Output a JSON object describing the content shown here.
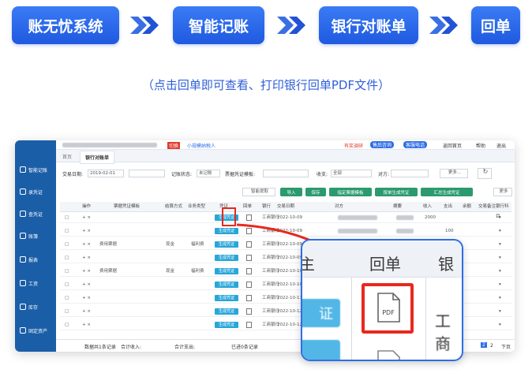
{
  "flow": {
    "steps": [
      "账无忧系统",
      "智能记账",
      "银行对账单",
      "回单"
    ]
  },
  "caption": "（点击回单即可查看、打印银行回单PDF文件）",
  "app": {
    "sidebar": [
      "智能记账",
      "录凭证",
      "查凭证",
      "账簿",
      "报表",
      "工资",
      "库存",
      "固定资产"
    ],
    "topbar": {
      "badge": "切换",
      "company": "小规模纳税人",
      "right_items": [
        "有奖调研",
        "售后咨询",
        "客服电话",
        "返回首页",
        "帮助",
        "退出"
      ]
    },
    "tabs": [
      "首页",
      "银行对账单"
    ],
    "filters": {
      "date_label": "交易日期:",
      "date_from": "2019-02-01",
      "record_label": "记账状态:",
      "record_value": "未记账",
      "template_label": "票据凭证模板:",
      "income_label": "收支:",
      "income_value": "全部",
      "party_label": "对方:",
      "more": "更多..."
    },
    "buttons": [
      "智能提取",
      "导入",
      "保存",
      "指定票据模板",
      "按单生成凭证",
      "汇总生成凭证",
      "更多"
    ],
    "columns": [
      "操作",
      "票据凭证模板",
      "结算方式",
      "业务类型",
      "凭证",
      "回单",
      "银行",
      "交易日期",
      "对方",
      "摘要",
      "收入",
      "支出",
      "余额",
      "交易备注",
      "银行科目"
    ],
    "rows": [
      {
        "template": "",
        "settle": "",
        "biz": "",
        "voucher": "生成凭证",
        "bank": "工商银行",
        "date": "2022-10-09",
        "income": "2000",
        "expense": ""
      },
      {
        "template": "",
        "settle": "",
        "biz": "",
        "voucher": "生成凭证",
        "bank": "工商银行",
        "date": "2022-10-09",
        "income": "",
        "expense": "100"
      },
      {
        "template": "费用票据",
        "settle": "现金",
        "biz": "福利费",
        "voucher": "生成凭证",
        "bank": "工商银行",
        "date": "2022-10-09",
        "income": "",
        "expense": ""
      },
      {
        "template": "",
        "settle": "",
        "biz": "",
        "voucher": "生成凭证",
        "bank": "工商银行",
        "date": "2022-10-09",
        "income": "",
        "expense": ""
      },
      {
        "template": "费用票据",
        "settle": "现金",
        "biz": "福利费",
        "voucher": "生成凭证",
        "bank": "工商银行",
        "date": "2022-10-10",
        "income": "",
        "expense": ""
      },
      {
        "template": "",
        "settle": "",
        "biz": "",
        "voucher": "生成凭证",
        "bank": "工商银行",
        "date": "2022-10-10",
        "income": "",
        "expense": ""
      },
      {
        "template": "",
        "settle": "",
        "biz": "",
        "voucher": "生成凭证",
        "bank": "工商银行",
        "date": "2022-10-11",
        "income": "",
        "expense": ""
      },
      {
        "template": "",
        "settle": "",
        "biz": "",
        "voucher": "生成凭证",
        "bank": "工商银行",
        "date": "2022-10-12",
        "income": "",
        "expense": ""
      },
      {
        "template": "",
        "settle": "",
        "biz": "",
        "voucher": "生成凭证",
        "bank": "工商银行",
        "date": "2022-10-12",
        "income": "",
        "expense": ""
      }
    ],
    "footer": {
      "total_records": "数据共1条记录",
      "income_total": "合计收入:",
      "expense_total": "合计支出:",
      "generated": "已进0条记录",
      "pages": [
        "2",
        "2"
      ],
      "next": "下页"
    }
  },
  "zoom": {
    "col_left": "主",
    "col_receipt": "回单",
    "col_right": "银",
    "voucher_btn": "证",
    "pdf_label": "PDF",
    "bank_text": "工商"
  },
  "colors": {
    "flow_blue": "#1f59e0",
    "highlight_red": "#e8281e",
    "sidebar": "#1b5ea8",
    "voucher_btn": "#29a6d8",
    "action_btn": "#2b9a6e"
  }
}
